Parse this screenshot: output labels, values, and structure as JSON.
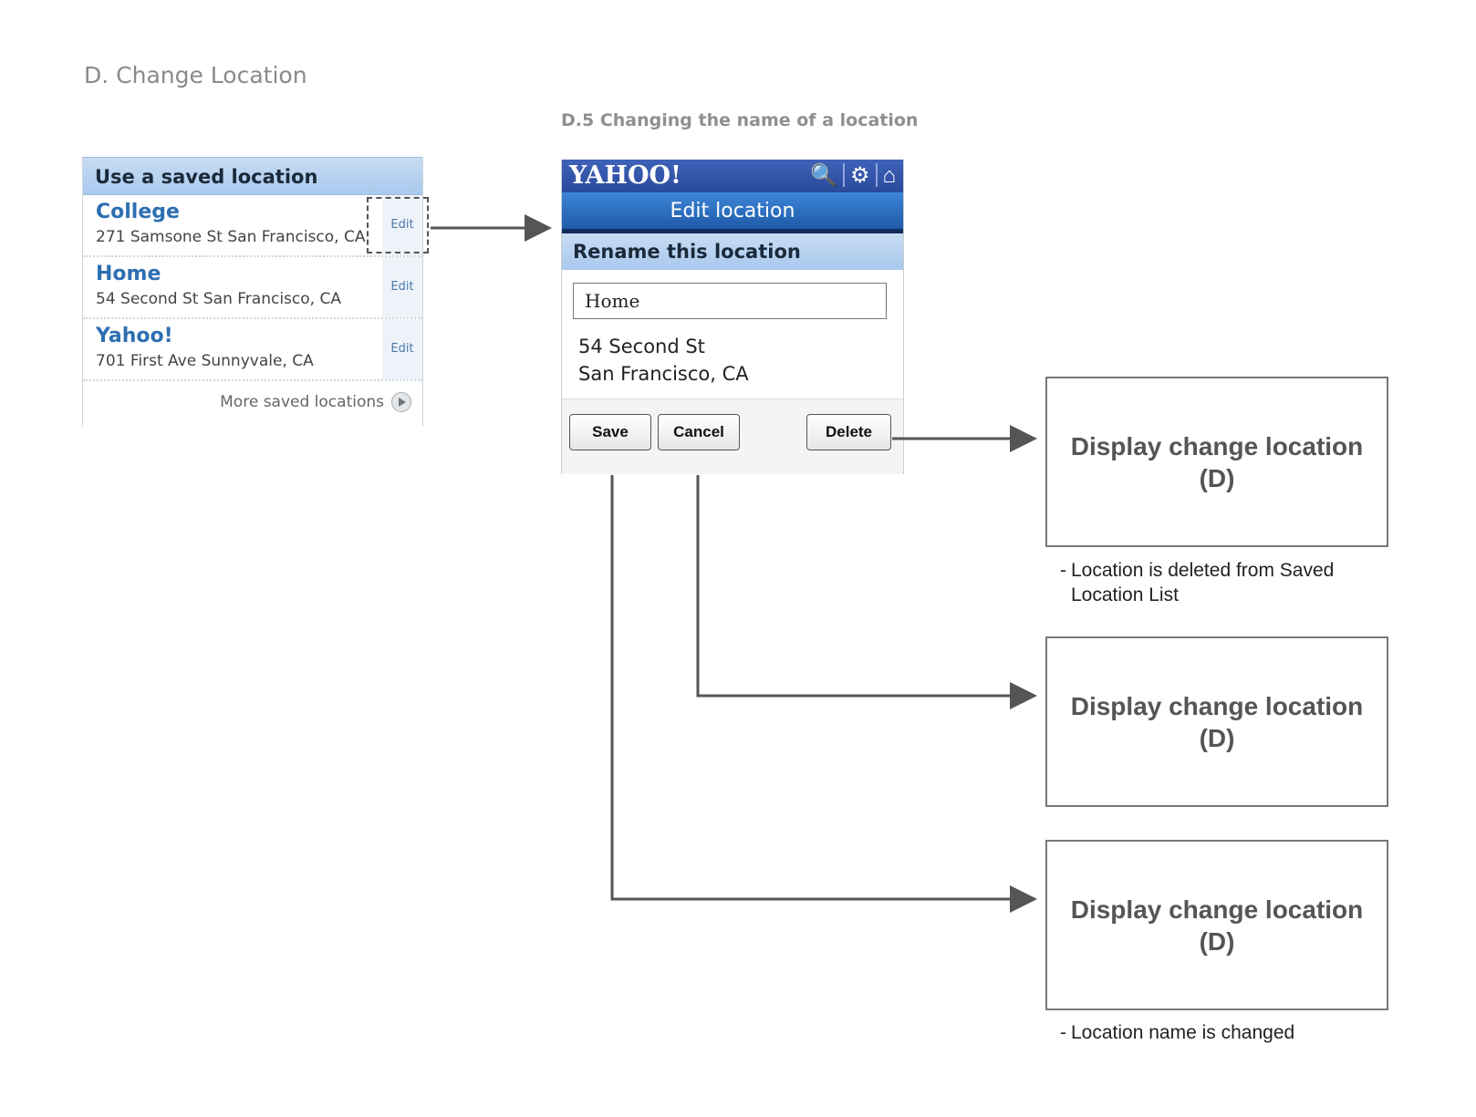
{
  "page_title": "D. Change Location",
  "section_title": "D.5 Changing the name of a location",
  "saved_locations": {
    "header": "Use a saved location",
    "items": [
      {
        "name": "College",
        "address": "271 Samsone St San Francisco, CA",
        "edit_label": "Edit"
      },
      {
        "name": "Home",
        "address": "54 Second St San Francisco, CA",
        "edit_label": "Edit"
      },
      {
        "name": "Yahoo!",
        "address": "701 First Ave Sunnyvale, CA",
        "edit_label": "Edit"
      }
    ],
    "more_label": "More saved locations"
  },
  "phone": {
    "logo": "YAHOO!",
    "icons": [
      "search-icon",
      "gear-icon",
      "home-icon"
    ],
    "title": "Edit location",
    "rename_header": "Rename this location",
    "name_value": "Home",
    "address_line1": "54 Second St",
    "address_line2": "San Francisco, CA",
    "buttons": {
      "save": "Save",
      "cancel": "Cancel",
      "delete": "Delete"
    }
  },
  "results": [
    {
      "line1": "Display change location",
      "line2": "(D)",
      "note_dash": "-",
      "note": "Location is deleted from Saved Location List"
    },
    {
      "line1": "Display change location",
      "line2": "(D)"
    },
    {
      "line1": "Display change location",
      "line2": "(D)",
      "note_dash": "-",
      "note": "Location name is changed"
    }
  ],
  "colors": {
    "link_blue": "#2d6fb2",
    "header_blue": "#a9c9ee",
    "yahoo_bar": "#2a4a9c",
    "title_bar": "#1f5aa8"
  }
}
